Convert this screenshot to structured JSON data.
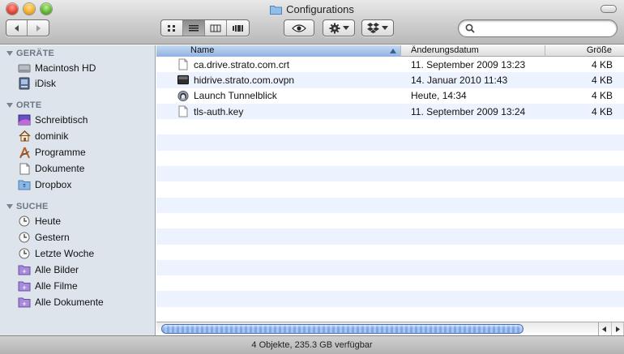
{
  "window": {
    "title": "Configurations"
  },
  "search": {
    "value": "",
    "placeholder": ""
  },
  "sidebar": {
    "sections": [
      {
        "title": "GERÄTE",
        "items": [
          {
            "label": "Macintosh HD",
            "icon": "hard-drive-icon"
          },
          {
            "label": "iDisk",
            "icon": "idisk-icon"
          }
        ]
      },
      {
        "title": "ORTE",
        "items": [
          {
            "label": "Schreibtisch",
            "icon": "desktop-icon"
          },
          {
            "label": "dominik",
            "icon": "home-icon"
          },
          {
            "label": "Programme",
            "icon": "applications-icon"
          },
          {
            "label": "Dokumente",
            "icon": "documents-icon"
          },
          {
            "label": "Dropbox",
            "icon": "dropbox-folder-icon"
          }
        ]
      },
      {
        "title": "SUCHE",
        "items": [
          {
            "label": "Heute",
            "icon": "clock-icon"
          },
          {
            "label": "Gestern",
            "icon": "clock-icon"
          },
          {
            "label": "Letzte Woche",
            "icon": "clock-icon"
          },
          {
            "label": "Alle Bilder",
            "icon": "smart-folder-icon"
          },
          {
            "label": "Alle Filme",
            "icon": "smart-folder-icon"
          },
          {
            "label": "Alle Dokumente",
            "icon": "smart-folder-icon"
          }
        ]
      }
    ]
  },
  "list": {
    "columns": {
      "name": "Name",
      "date": "Änderungsdatum",
      "size": "Größe"
    },
    "files": [
      {
        "name": "ca.drive.strato.com.crt",
        "date": "11. September 2009 13:23",
        "size": "4 KB",
        "icon": "certificate-file-icon"
      },
      {
        "name": "hidrive.strato.com.ovpn",
        "date": "14. Januar 2010 11:43",
        "size": "4 KB",
        "icon": "ovpn-file-icon"
      },
      {
        "name": "Launch Tunnelblick",
        "date": "Heute, 14:34",
        "size": "4 KB",
        "icon": "tunnelblick-app-icon"
      },
      {
        "name": "tls-auth.key",
        "date": "11. September 2009 13:24",
        "size": "4 KB",
        "icon": "key-file-icon"
      }
    ]
  },
  "status": {
    "text": "4 Objekte, 235.3 GB verfügbar"
  },
  "colors": {
    "sidebar_bg": "#dde4ec",
    "row_alt": "#edf3fe",
    "header_selected": "#8fb2e3"
  }
}
